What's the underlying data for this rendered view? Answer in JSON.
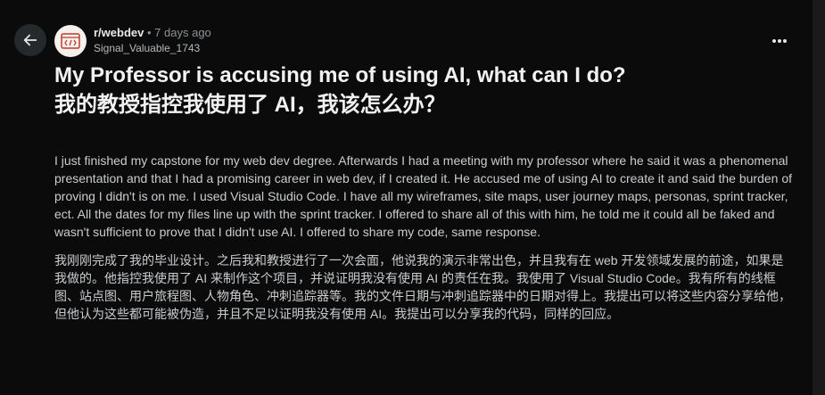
{
  "post": {
    "subreddit": "r/webdev",
    "separator": "•",
    "time": "7 days ago",
    "author": "Signal_Valuable_1743",
    "title_en": "My Professor is accusing me of using AI, what can I do?",
    "title_zh": "我的教授指控我使用了 AI，我该怎么办？",
    "body_en": "I just finished my capstone for my web dev degree. Afterwards I had a meeting with my professor where he said it was a phenomenal presentation and that I had a promising career in web dev, if I created it. He accused me of using AI to create it and said the burden of proving I didn't is on me. I used Visual Studio Code. I have all my wireframes, site maps, user journey maps, personas, sprint tracker, ect. All the dates for my files line up with the sprint tracker. I offered to share all of this with him, he told me it could all be faked and wasn't sufficient to prove that I didn't use AI. I offered to share my code, same response.",
    "body_zh": "我刚刚完成了我的毕业设计。之后我和教授进行了一次会面，他说我的演示非常出色，并且我有在 web 开发领域发展的前途，如果是我做的。他指控我使用了 AI 来制作这个项目，并说证明我没有使用 AI 的责任在我。我使用了 Visual Studio Code。我有所有的线框图、站点图、用户旅程图、人物角色、冲刺追踪器等。我的文件日期与冲刺追踪器中的日期对得上。我提出可以将这些内容分享给他，但他认为这些都可能被伪造，并且不足以证明我没有使用 AI。我提出可以分享我的代码，同样的回应。"
  },
  "icons": {
    "back": "arrow-left-icon",
    "avatar": "code-bracket-icon",
    "more": "more-horizontal-icon"
  },
  "colors": {
    "background": "#0b0b0b",
    "avatar_accent": "#c0392b"
  }
}
